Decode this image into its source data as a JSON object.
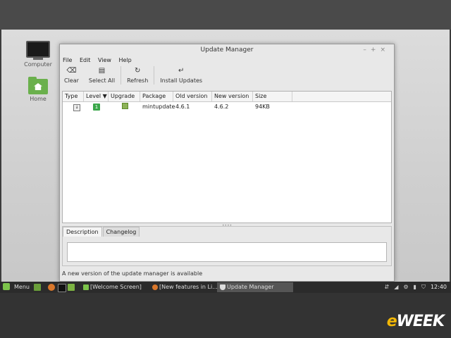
{
  "desktop": {
    "icons": [
      {
        "label": "Computer",
        "icon": "monitor-icon"
      },
      {
        "label": "Home",
        "icon": "home-folder-icon"
      }
    ]
  },
  "window": {
    "title": "Update Manager",
    "controls": [
      "–",
      "+",
      "×"
    ],
    "menu": [
      "File",
      "Edit",
      "View",
      "Help"
    ],
    "toolbar": [
      {
        "label": "Clear",
        "icon": "clear-icon"
      },
      {
        "label": "Select All",
        "icon": "select-all-icon"
      },
      {
        "label": "Refresh",
        "icon": "refresh-icon"
      },
      {
        "label": "Install Updates",
        "icon": "install-icon"
      }
    ],
    "table": {
      "columns": [
        "Type",
        "Level",
        "Upgrade",
        "Package",
        "Old version",
        "New version",
        "Size"
      ],
      "sort_indicator": "▼",
      "rows": [
        {
          "type_icon": "download-icon",
          "level": "1",
          "upgrade": "checked",
          "package": "mintupdate",
          "old_version": "4.6.1",
          "new_version": "4.6.2",
          "size": "94KB"
        }
      ]
    },
    "tabs": [
      "Description",
      "Changelog"
    ],
    "status": "A new version of the update manager is available"
  },
  "taskbar": {
    "menu_label": "Menu",
    "tasks": [
      "[Welcome Screen]",
      "[New features in Li...",
      "Update Manager"
    ],
    "clock": "12:40"
  },
  "watermark": {
    "prefix": "e",
    "text": "WEEK"
  },
  "colors": {
    "level_badge": "#3aa64a",
    "mint_green": "#7cc34a",
    "watermark_accent": "#f2b705"
  }
}
